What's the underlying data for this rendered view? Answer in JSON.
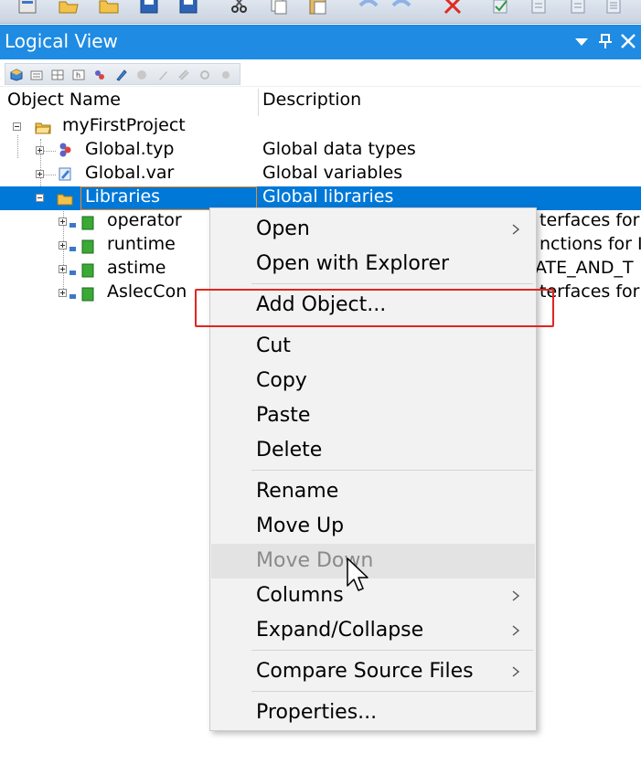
{
  "panel": {
    "title": "Logical View"
  },
  "columns": {
    "name": "Object Name",
    "description": "Description"
  },
  "tree": {
    "root": {
      "name": "myFirstProject"
    },
    "rows": [
      {
        "name": "Global.typ",
        "description": "Global data types"
      },
      {
        "name": "Global.var",
        "description": "Global variables"
      },
      {
        "name": "Libraries",
        "description": "Global libraries"
      },
      {
        "name": "operator",
        "description": "terfaces for"
      },
      {
        "name": "runtime",
        "description": "nctions for IE"
      },
      {
        "name": "astime",
        "description": "ATE_AND_T"
      },
      {
        "name": "AslecCon",
        "description": "terfaces for"
      }
    ]
  },
  "context_menu": {
    "items": [
      {
        "label": "Open"
      },
      {
        "label": "Open with Explorer"
      },
      {
        "label": "Add Object..."
      },
      {
        "label": "Cut"
      },
      {
        "label": "Copy"
      },
      {
        "label": "Paste"
      },
      {
        "label": "Delete"
      },
      {
        "label": "Rename"
      },
      {
        "label": "Move Up"
      },
      {
        "label": "Move Down"
      },
      {
        "label": "Columns"
      },
      {
        "label": "Expand/Collapse"
      },
      {
        "label": "Compare Source Files"
      },
      {
        "label": "Properties..."
      }
    ]
  },
  "colors": {
    "title_bar": "#1f8be2",
    "selection": "#0078d7",
    "highlight_box": "#e0251f",
    "menu_background": "#f2f2f2",
    "library_icon": "#3aa935"
  }
}
